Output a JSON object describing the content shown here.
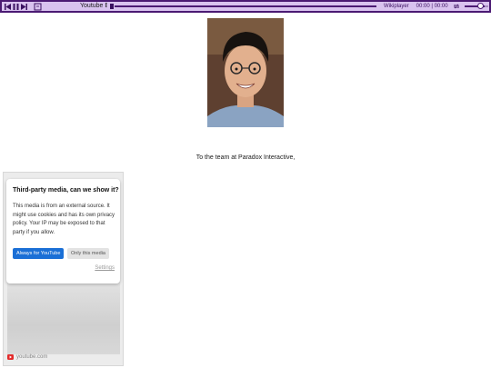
{
  "player": {
    "title": "Youtube E",
    "source_label": "Wikiplayer",
    "time": "00:00 | 00:00",
    "volume": 0.8,
    "progress": 0
  },
  "letter": {
    "greeting": "To the team at Paradox Interactive,"
  },
  "embed": {
    "consent": {
      "title": "Third-party media, can we show it?",
      "body": "This media is from an external source. It might use cookies and has its own privacy policy. Your IP may be exposed to that party if you allow.",
      "allow_label": "Always for YouTube",
      "once_label": "Only this media",
      "settings_label": "Settings"
    },
    "footer_text": "youtube.com"
  },
  "colors": {
    "player_bar": "#4b1a73",
    "player_inner": "#d9c3ef",
    "allow_button": "#1a6fd6",
    "youtube_red": "#e32b2b"
  }
}
